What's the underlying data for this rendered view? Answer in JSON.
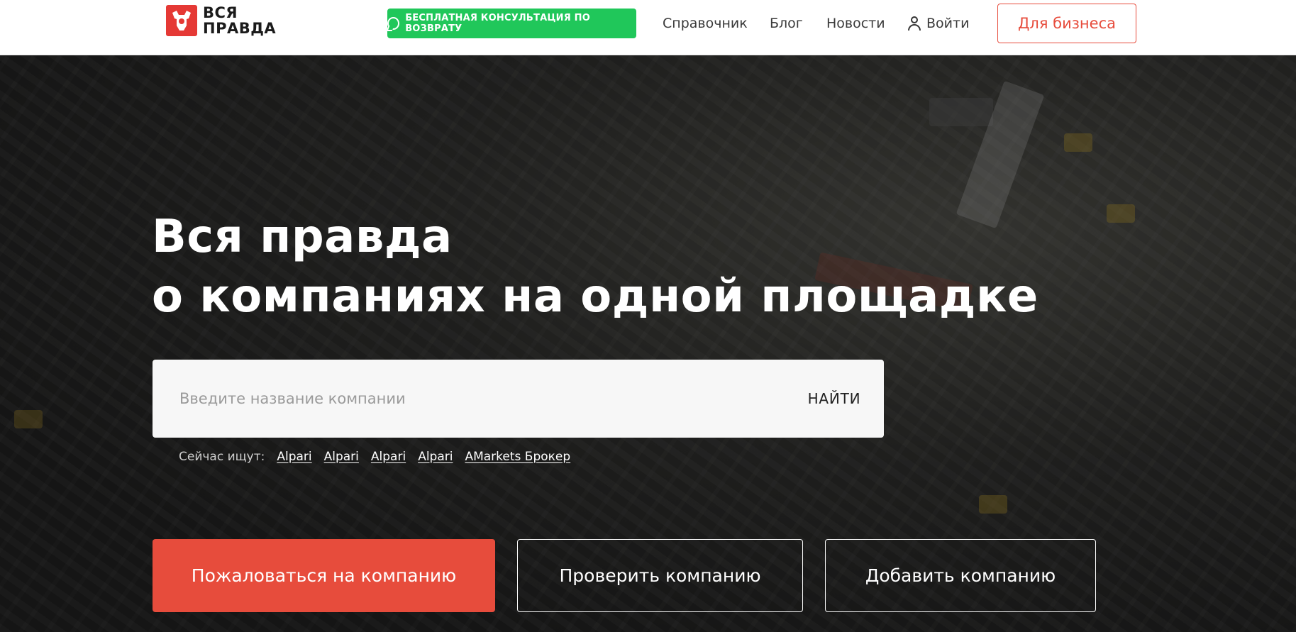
{
  "header": {
    "logo_line1": "ВСЯ",
    "logo_line2": "ПРАВДА",
    "consult_label": "БЕСПЛАТНАЯ КОНСУЛЬТАЦИЯ ПО ВОЗВРАТУ",
    "nav": {
      "reference": "Справочник",
      "blog": "Блог",
      "news": "Новости",
      "login": "Войти"
    },
    "business_label": "Для бизнеса"
  },
  "hero": {
    "title_line1": "Вся правда",
    "title_line2": "о компаниях на одной площадке",
    "search": {
      "placeholder": "Введите название компании",
      "value": "",
      "button": "НАЙТИ"
    },
    "trending_label": "Сейчас ищут:",
    "trending": [
      "Alpari",
      "Alpari",
      "Alpari",
      "Alpari",
      "AMarkets Брокер"
    ],
    "actions": {
      "complain": "Пожаловаться на компанию",
      "check": "Проверить компанию",
      "add": "Добавить компанию"
    }
  },
  "colors": {
    "brand_red": "#e74c3c",
    "whatsapp_green": "#20c75a"
  }
}
